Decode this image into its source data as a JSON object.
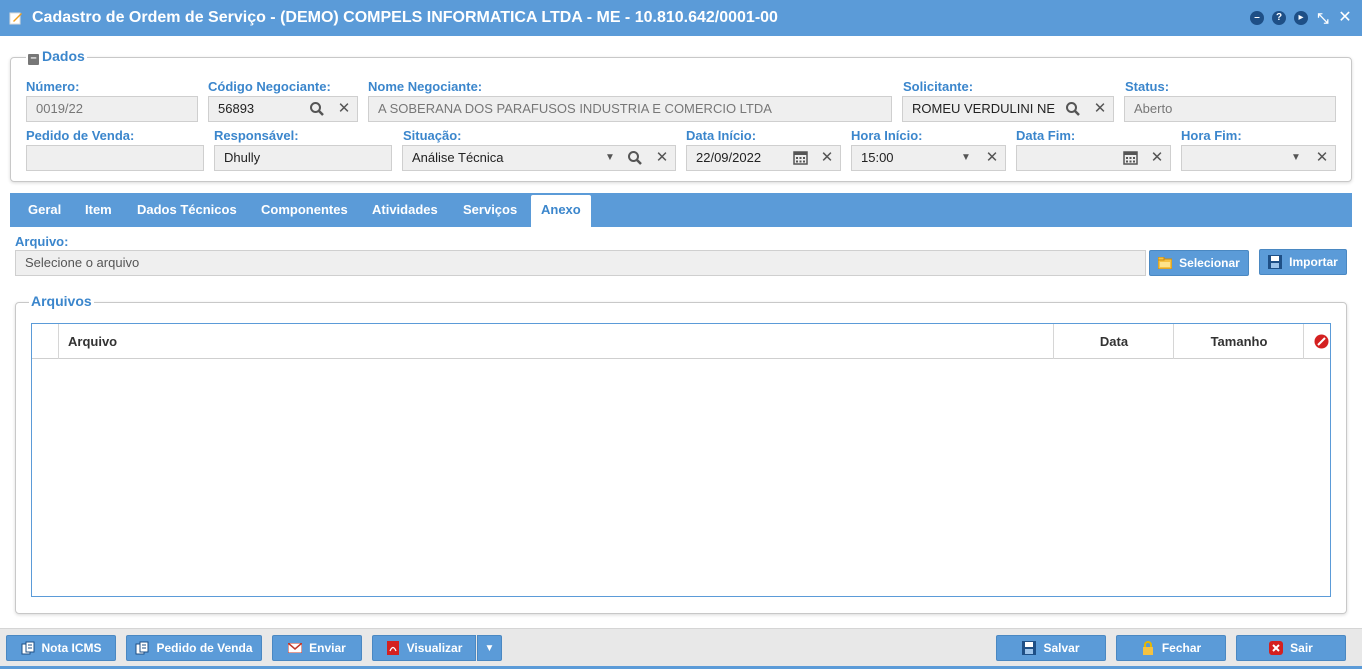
{
  "window": {
    "title": "Cadastro de Ordem de Serviço - (DEMO) COMPELS INFORMATICA LTDA - ME - 10.810.642/0001-00"
  },
  "dados": {
    "legend": "Dados",
    "numero": {
      "label": "Número:",
      "value": "0019/22"
    },
    "codigo_negociante": {
      "label": "Código Negociante:",
      "value": "56893"
    },
    "nome_negociante": {
      "label": "Nome Negociante:",
      "value": "A SOBERANA DOS PARAFUSOS INDUSTRIA E COMERCIO LTDA"
    },
    "solicitante": {
      "label": "Solicitante:",
      "value": "ROMEU VERDULINI NE"
    },
    "status": {
      "label": "Status:",
      "value": "Aberto"
    },
    "pedido_venda": {
      "label": "Pedido de Venda:",
      "value": ""
    },
    "responsavel": {
      "label": "Responsável:",
      "value": "Dhully"
    },
    "situacao": {
      "label": "Situação:",
      "value": "Análise Técnica"
    },
    "data_inicio": {
      "label": "Data Início:",
      "value": "22/09/2022"
    },
    "hora_inicio": {
      "label": "Hora Início:",
      "value": "15:00"
    },
    "data_fim": {
      "label": "Data Fim:",
      "value": ""
    },
    "hora_fim": {
      "label": "Hora Fim:",
      "value": ""
    }
  },
  "tabs": [
    "Geral",
    "Item",
    "Dados Técnicos",
    "Componentes",
    "Atividades",
    "Serviços",
    "Anexo"
  ],
  "active_tab": "Anexo",
  "anexo": {
    "arquivo_label": "Arquivo:",
    "arquivo_placeholder": "Selecione o arquivo",
    "selecionar_label": "Selecionar",
    "importar_label": "Importar",
    "arquivos_legend": "Arquivos",
    "columns": [
      "Arquivo",
      "Data",
      "Tamanho"
    ],
    "rows": []
  },
  "footer": {
    "nota_icms": "Nota ICMS",
    "pedido_venda": "Pedido de Venda",
    "enviar": "Enviar",
    "visualizar": "Visualizar",
    "salvar": "Salvar",
    "fechar": "Fechar",
    "sair": "Sair"
  },
  "colors": {
    "accent": "#5b9bd8",
    "label": "#3b86cc"
  }
}
